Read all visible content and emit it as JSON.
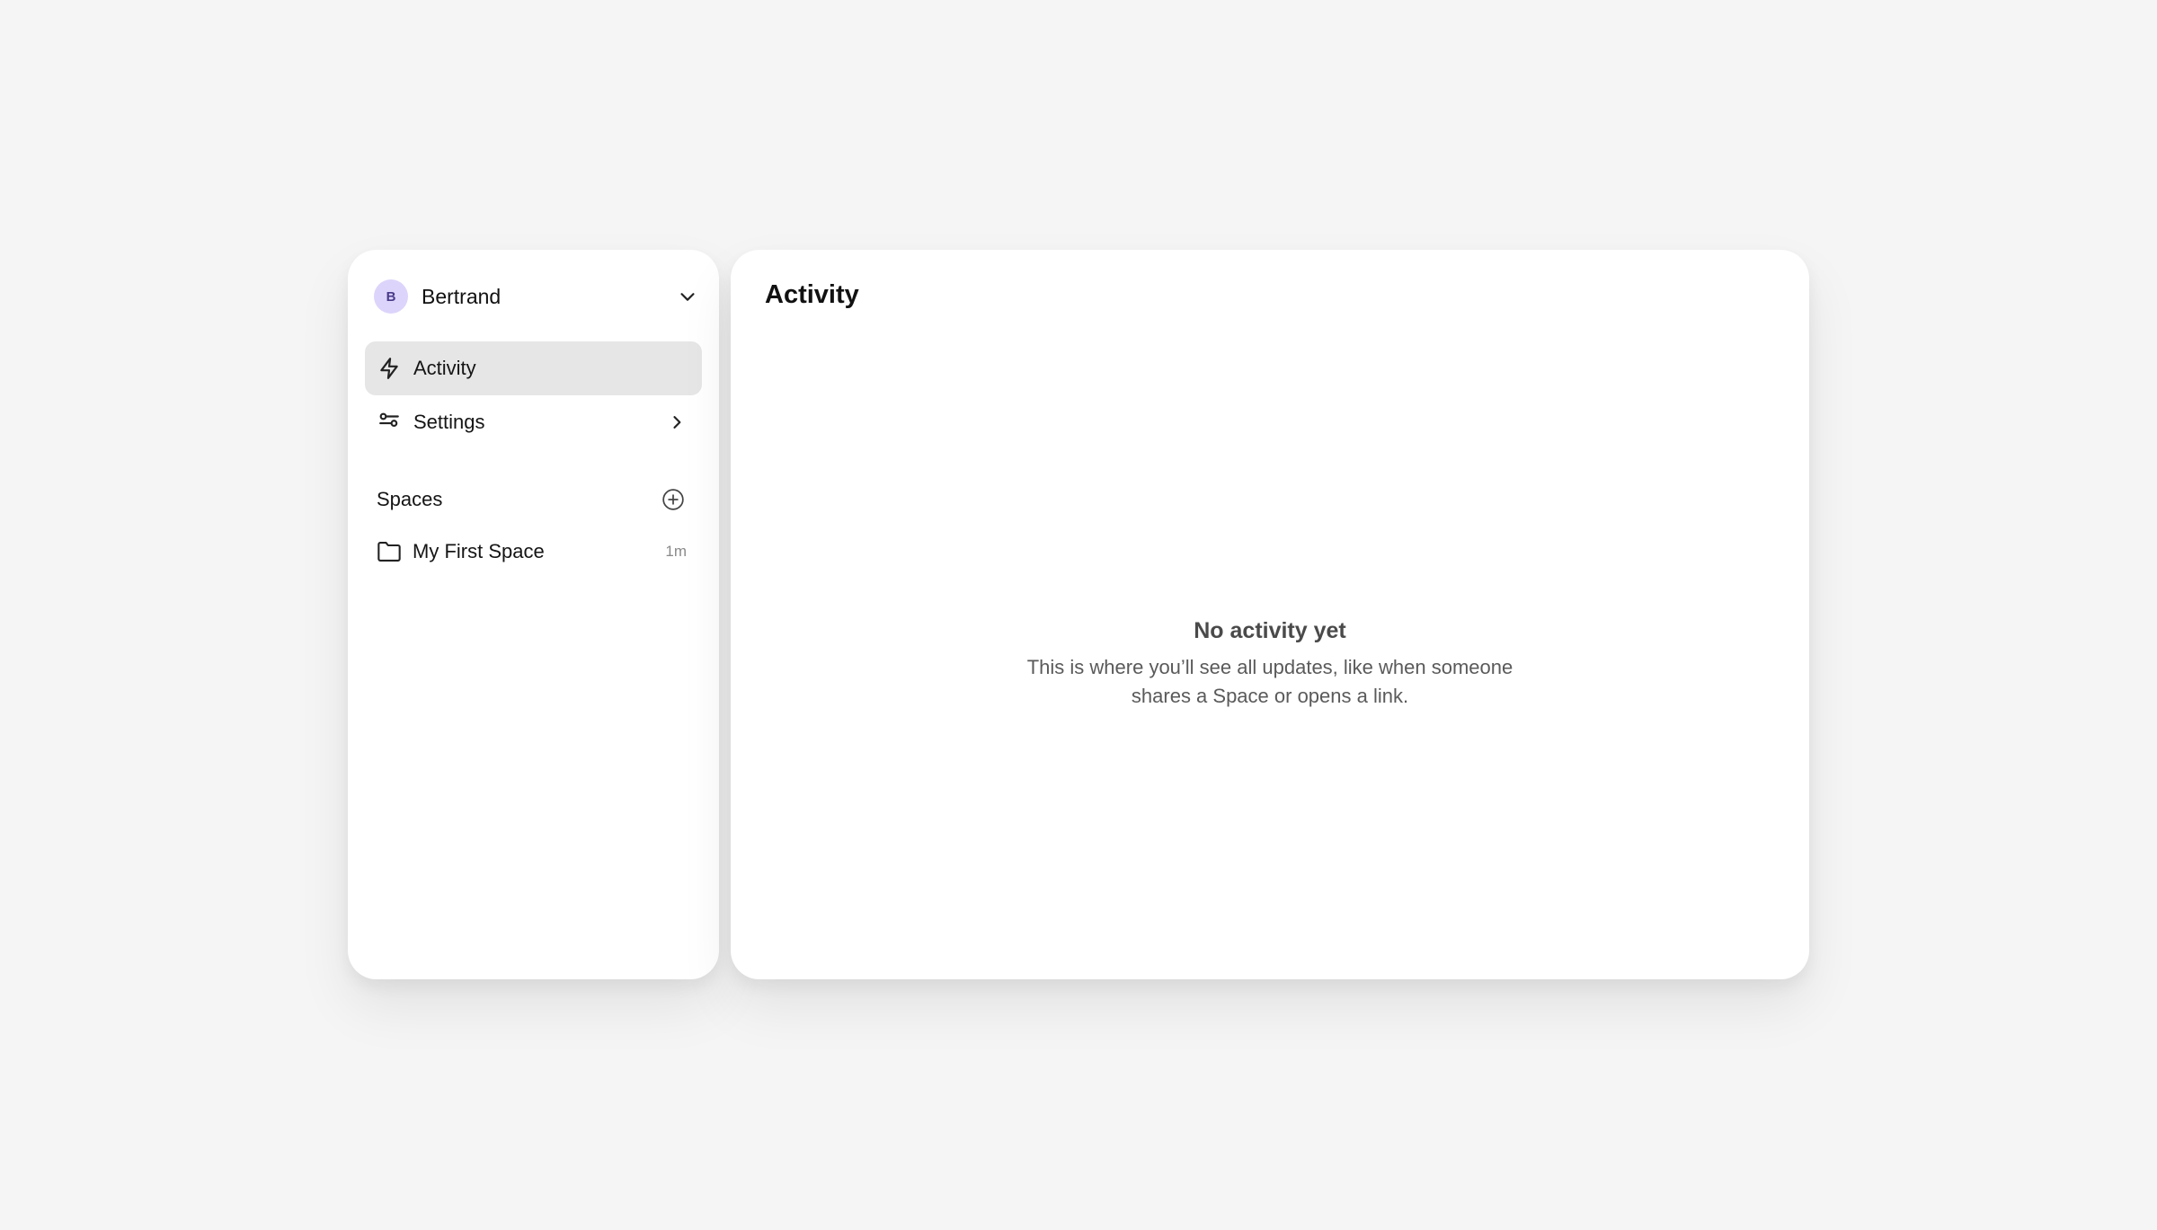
{
  "account": {
    "avatar_initial": "B",
    "name": "Bertrand"
  },
  "nav": {
    "activity_label": "Activity",
    "settings_label": "Settings"
  },
  "spaces": {
    "title": "Spaces",
    "items": [
      {
        "label": "My First Space",
        "time": "1m"
      }
    ]
  },
  "main": {
    "title": "Activity",
    "empty_title": "No activity yet",
    "empty_description": "This is where you’ll see all updates, like when someone shares a Space or opens a link."
  },
  "colors": {
    "background": "#f5f5f5",
    "panel": "#ffffff",
    "active_nav": "#e6e6e6",
    "avatar_bg": "#ddd4fb"
  }
}
